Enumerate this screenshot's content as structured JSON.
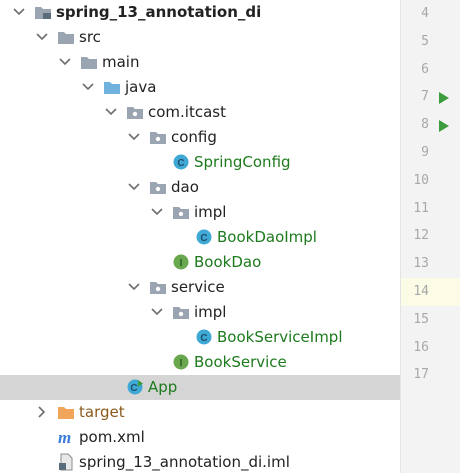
{
  "tree": {
    "rows": [
      {
        "label": "spring_13_annotation_di",
        "bold": true,
        "icon": "module-folder-icon",
        "arrow": "expanded"
      },
      {
        "label": "src",
        "icon": "folder-icon",
        "arrow": "expanded"
      },
      {
        "label": "main",
        "icon": "folder-icon",
        "arrow": "expanded"
      },
      {
        "label": "java",
        "icon": "source-root-folder-icon",
        "arrow": "expanded"
      },
      {
        "label": "com.itcast",
        "icon": "package-icon",
        "arrow": "expanded"
      },
      {
        "label": "config",
        "icon": "package-icon",
        "arrow": "expanded"
      },
      {
        "label": "SpringConfig",
        "icon": "class-icon",
        "type": "class"
      },
      {
        "label": "dao",
        "icon": "package-icon",
        "arrow": "expanded"
      },
      {
        "label": "impl",
        "icon": "package-icon",
        "arrow": "expanded"
      },
      {
        "label": "BookDaoImpl",
        "icon": "class-icon",
        "type": "class"
      },
      {
        "label": "BookDao",
        "icon": "interface-icon",
        "type": "class"
      },
      {
        "label": "service",
        "icon": "package-icon",
        "arrow": "expanded"
      },
      {
        "label": "impl",
        "icon": "package-icon",
        "arrow": "expanded"
      },
      {
        "label": "BookServiceImpl",
        "icon": "class-icon",
        "type": "class"
      },
      {
        "label": "BookService",
        "icon": "interface-icon",
        "type": "class"
      },
      {
        "label": "App",
        "icon": "runnable-class-icon",
        "type": "class",
        "selected": true
      },
      {
        "label": "target",
        "icon": "excluded-folder-icon",
        "arrow": "collapsed",
        "type": "target"
      },
      {
        "label": "pom.xml",
        "icon": "maven-icon"
      },
      {
        "label": "spring_13_annotation_di.iml",
        "icon": "iml-file-icon"
      }
    ]
  },
  "gutter": {
    "line_numbers": [
      "4",
      "5",
      "6",
      "7",
      "8",
      "9",
      "10",
      "11",
      "12",
      "13",
      "14",
      "15",
      "16",
      "17"
    ],
    "run_lines": [
      "7",
      "8"
    ],
    "current_line": "14"
  },
  "colors": {
    "class_text": "#1d7a1d",
    "class_icon": "#3fa9d6",
    "interface_icon": "#6aa84f",
    "folder": "#9aa5b1",
    "source_folder": "#6fb2dd",
    "target_folder": "#f0a55a",
    "run_arrow": "#3c9c3c",
    "selection": "#d5d5d5"
  }
}
